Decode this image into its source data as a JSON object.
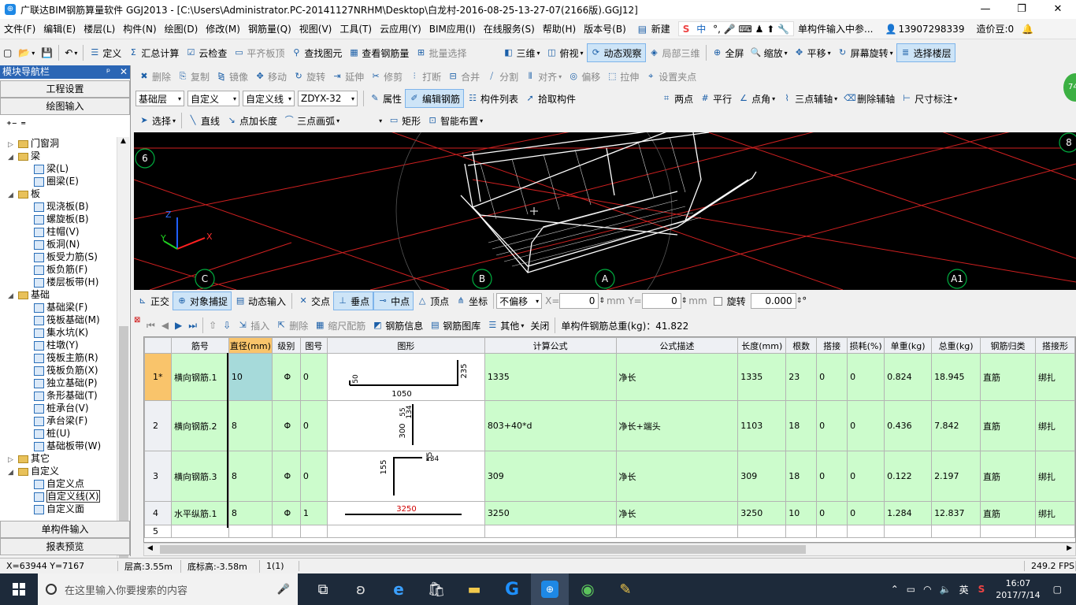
{
  "window": {
    "title": "广联达BIM钢筋算量软件 GGJ2013 - [C:\\Users\\Administrator.PC-20141127NRHM\\Desktop\\白龙村-2016-08-25-13-27-07(2166版).GGJ12]",
    "minimize": "—",
    "restore": "❐",
    "close": "✕"
  },
  "menu": {
    "items": [
      "文件(F)",
      "编辑(E)",
      "楼层(L)",
      "构件(N)",
      "绘图(D)",
      "修改(M)",
      "钢筋量(Q)",
      "视图(V)",
      "工具(T)",
      "云应用(Y)",
      "BIM应用(I)",
      "在线服务(S)",
      "帮助(H)",
      "版本号(B)"
    ],
    "new_btn": "新建",
    "ime_mode": "中",
    "right_hint": "单构件输入中参...",
    "phone": "13907298339",
    "beans": "造价豆:0"
  },
  "toolbar1": {
    "items": [
      "定义",
      "汇总计算",
      "云检查",
      "平齐板顶",
      "查找图元",
      "查看钢筋量",
      "批量选择"
    ],
    "view_items": [
      "三维",
      "俯视",
      "动态观察",
      "局部三维",
      "全屏",
      "缩放",
      "平移",
      "屏幕旋转",
      "选择楼层"
    ]
  },
  "toolbar2": {
    "items": [
      "删除",
      "复制",
      "镜像",
      "移动",
      "旋转",
      "延伸",
      "修剪",
      "打断",
      "合并",
      "分割",
      "对齐",
      "偏移",
      "拉伸",
      "设置夹点"
    ]
  },
  "toolbar3": {
    "floor": "基础层",
    "category": "自定义",
    "type": "自定义线",
    "code": "ZDYX-32",
    "items": [
      "属性",
      "编辑钢筋",
      "构件列表",
      "拾取构件"
    ],
    "axis_items": [
      "两点",
      "平行",
      "点角",
      "三点辅轴",
      "删除辅轴",
      "尺寸标注"
    ]
  },
  "toolbar4": {
    "items": [
      "选择",
      "直线",
      "点加长度",
      "三点画弧",
      "矩形",
      "智能布置"
    ]
  },
  "left_panel": {
    "title": "模块导航栏",
    "pin": "ᵖ",
    "close": "✕",
    "btn_settings": "工程设置",
    "btn_drawing": "绘图输入",
    "btn_single": "单构件输入",
    "btn_report": "报表预览",
    "tree": [
      {
        "level": 1,
        "expander": "▷",
        "kind": "folder",
        "label": "门窗洞"
      },
      {
        "level": 1,
        "expander": "◢",
        "kind": "folder",
        "label": "梁"
      },
      {
        "level": 2,
        "expander": "",
        "kind": "leaf",
        "label": "梁(L)"
      },
      {
        "level": 2,
        "expander": "",
        "kind": "leaf",
        "label": "圈梁(E)"
      },
      {
        "level": 1,
        "expander": "◢",
        "kind": "folder",
        "label": "板"
      },
      {
        "level": 2,
        "expander": "",
        "kind": "leaf",
        "label": "现浇板(B)"
      },
      {
        "level": 2,
        "expander": "",
        "kind": "leaf",
        "label": "螺旋板(B)"
      },
      {
        "level": 2,
        "expander": "",
        "kind": "leaf",
        "label": "柱帽(V)"
      },
      {
        "level": 2,
        "expander": "",
        "kind": "leaf",
        "label": "板洞(N)"
      },
      {
        "level": 2,
        "expander": "",
        "kind": "leaf",
        "label": "板受力筋(S)"
      },
      {
        "level": 2,
        "expander": "",
        "kind": "leaf",
        "label": "板负筋(F)"
      },
      {
        "level": 2,
        "expander": "",
        "kind": "leaf",
        "label": "楼层板带(H)"
      },
      {
        "level": 1,
        "expander": "◢",
        "kind": "folder",
        "label": "基础"
      },
      {
        "level": 2,
        "expander": "",
        "kind": "leaf",
        "label": "基础梁(F)"
      },
      {
        "level": 2,
        "expander": "",
        "kind": "leaf",
        "label": "筏板基础(M)"
      },
      {
        "level": 2,
        "expander": "",
        "kind": "leaf",
        "label": "集水坑(K)"
      },
      {
        "level": 2,
        "expander": "",
        "kind": "leaf",
        "label": "柱墩(Y)"
      },
      {
        "level": 2,
        "expander": "",
        "kind": "leaf",
        "label": "筏板主筋(R)"
      },
      {
        "level": 2,
        "expander": "",
        "kind": "leaf",
        "label": "筏板负筋(X)"
      },
      {
        "level": 2,
        "expander": "",
        "kind": "leaf",
        "label": "独立基础(P)"
      },
      {
        "level": 2,
        "expander": "",
        "kind": "leaf",
        "label": "条形基础(T)"
      },
      {
        "level": 2,
        "expander": "",
        "kind": "leaf",
        "label": "桩承台(V)"
      },
      {
        "level": 2,
        "expander": "",
        "kind": "leaf",
        "label": "承台梁(F)"
      },
      {
        "level": 2,
        "expander": "",
        "kind": "leaf",
        "label": "桩(U)"
      },
      {
        "level": 2,
        "expander": "",
        "kind": "leaf",
        "label": "基础板带(W)"
      },
      {
        "level": 1,
        "expander": "▷",
        "kind": "folder",
        "label": "其它"
      },
      {
        "level": 1,
        "expander": "◢",
        "kind": "folder",
        "label": "自定义"
      },
      {
        "level": 2,
        "expander": "",
        "kind": "leaf",
        "label": "自定义点"
      },
      {
        "level": 2,
        "expander": "",
        "kind": "leaf",
        "label": "自定义线(X)"
      },
      {
        "level": 2,
        "expander": "",
        "kind": "leaf",
        "label": "自定义面"
      }
    ]
  },
  "canvas": {
    "axis_labels": [
      "6",
      "C",
      "B",
      "A",
      "A1",
      "8"
    ],
    "axis_x": "X",
    "axis_y": "Y",
    "axis_z": "Z",
    "badge": "74"
  },
  "snapbar": {
    "items": [
      "正交",
      "对象捕捉",
      "动态输入",
      "交点",
      "垂点",
      "中点",
      "顶点",
      "坐标"
    ],
    "offset": "不偏移",
    "x_label": "X=",
    "x_value": "0",
    "y_label": "Y=",
    "y_value": "0",
    "unit": "mm",
    "rotate_label": "旋转",
    "rotate_value": "0.000",
    "degree": "°"
  },
  "grid_toolbar": {
    "items": [
      "插入",
      "删除",
      "缩尺配筋",
      "钢筋信息",
      "钢筋图库",
      "其他",
      "关闭"
    ],
    "total_label": "单构件钢筋总重(kg)：41.822"
  },
  "table": {
    "columns": [
      "",
      "筋号",
      "直径(mm)",
      "级别",
      "图号",
      "图形",
      "计算公式",
      "公式描述",
      "长度(mm)",
      "根数",
      "搭接",
      "损耗(%)",
      "单重(kg)",
      "总重(kg)",
      "钢筋归类",
      "搭接形"
    ],
    "rows": [
      {
        "rn": "1*",
        "name": "横向钢筋.1",
        "dia": "10",
        "grade": "Φ",
        "fig": "0",
        "formula": "1335",
        "desc": "净长",
        "len": "1335",
        "count": "23",
        "lap": "0",
        "loss": "0",
        "unit_w": "0.824",
        "total_w": "18.945",
        "cat": "直筋",
        "lap_type": "绑扎",
        "shape": {
          "a": "235",
          "b": "1050",
          "c": "50"
        }
      },
      {
        "rn": "2",
        "name": "横向钢筋.2",
        "dia": "8",
        "grade": "Φ",
        "fig": "0",
        "formula": "803+40*d",
        "desc": "净长+端头",
        "len": "1103",
        "count": "18",
        "lap": "0",
        "loss": "0",
        "unit_w": "0.436",
        "total_w": "7.842",
        "cat": "直筋",
        "lap_type": "绑扎",
        "shape": {
          "a": "300",
          "b": "55",
          "c": "134"
        }
      },
      {
        "rn": "3",
        "name": "横向钢筋.3",
        "dia": "8",
        "grade": "Φ",
        "fig": "0",
        "formula": "309",
        "desc": "净长",
        "len": "309",
        "count": "18",
        "lap": "0",
        "loss": "0",
        "unit_w": "0.122",
        "total_w": "2.197",
        "cat": "直筋",
        "lap_type": "绑扎",
        "shape": {
          "a": "155",
          "b": "134",
          "c": "55"
        }
      },
      {
        "rn": "4",
        "name": "水平纵筋.1",
        "dia": "8",
        "grade": "Φ",
        "fig": "1",
        "formula": "3250",
        "desc": "净长",
        "len": "3250",
        "count": "10",
        "lap": "0",
        "loss": "0",
        "unit_w": "1.284",
        "total_w": "12.837",
        "cat": "直筋",
        "lap_type": "绑扎",
        "shape": {
          "a": "3250",
          "b": "",
          "c": ""
        }
      },
      {
        "rn": "5",
        "name": "",
        "dia": "",
        "grade": "",
        "fig": "",
        "formula": "",
        "desc": "",
        "len": "",
        "count": "",
        "lap": "",
        "loss": "",
        "unit_w": "",
        "total_w": "",
        "cat": "",
        "lap_type": "",
        "shape": {
          "a": "",
          "b": "",
          "c": ""
        }
      }
    ]
  },
  "status": {
    "coords": "X=63944 Y=7167",
    "floor_height": "层高:3.55m",
    "base_height": "底标高:-3.58m",
    "count": "1(1)",
    "fps": "249.2 FPS"
  },
  "taskbar": {
    "search_placeholder": "在这里输入你要搜索的内容",
    "ime": "英",
    "time": "16:07",
    "date": "2017/7/14"
  },
  "colors": {
    "accent": "#2b66b5",
    "grid_green": "#ccfccc",
    "grid_header_highlight": "#f9c46b",
    "canvas_bg": "#000000",
    "axis_red": "#e02020",
    "axis_green": "#00c040"
  }
}
